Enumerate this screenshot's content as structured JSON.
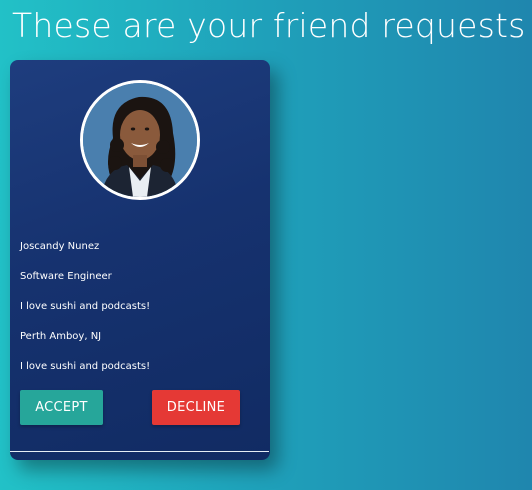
{
  "page": {
    "title": "These are your friend requests"
  },
  "friend_request": {
    "name": "Joscandy Nunez",
    "job": "Software Engineer",
    "bio": "I love sushi and podcasts!",
    "location": "Perth Amboy, NJ",
    "interests": "I love sushi and podcasts!",
    "accept_label": "ACCEPT",
    "decline_label": "DECLINE"
  },
  "colors": {
    "accept": "#26a69a",
    "decline": "#e53935",
    "card": "#16326f"
  }
}
